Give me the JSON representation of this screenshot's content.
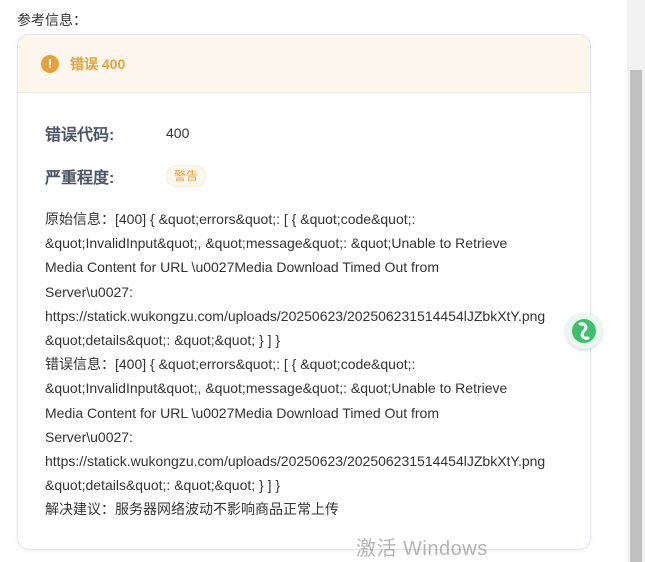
{
  "reference_label": "参考信息：",
  "card": {
    "title": "错误 400",
    "error_code_label": "错误代码:",
    "error_code_value": "400",
    "severity_label": "严重程度:",
    "severity_value": "警告",
    "detail_lines": [
      "原始信息：[400] { &quot;errors&quot;: [ { &quot;code&quot;:",
      "&quot;InvalidInput&quot;, &quot;message&quot;: &quot;Unable to Retrieve",
      "Media Content for URL \\u0027Media Download Timed Out from",
      "Server\\u0027:",
      "https://statick.wukongzu.com/uploads/20250623/20250623151445 4lJZbkXtY.png",
      "&quot;details&quot;: &quot;&quot; } ] }",
      "错误信息：[400] { &quot;errors&quot;: [ { &quot;code&quot;:",
      "&quot;InvalidInput&quot;, &quot;message&quot;: &quot;Unable to Retrieve",
      "Media Content for URL \\u0027Media Download Timed Out from",
      "Server\\u0027:",
      "https://statick.wukongzu.com/uploads/20250623/20250623151445 4lJZbkXtY.png",
      "&quot;details&quot;: &quot;&quot; } ] }",
      "解决建议：服务器网络波动不影响商品正常上传"
    ]
  },
  "watermark": "激活 Windows",
  "icons": {
    "header": "exclamation-circle-icon",
    "float": "assistant-logo-icon"
  },
  "colors": {
    "warning": "#e6a23c",
    "header_bg": "#fdf6ec",
    "label": "#4a5565",
    "float_green": "#3fbf6e"
  }
}
